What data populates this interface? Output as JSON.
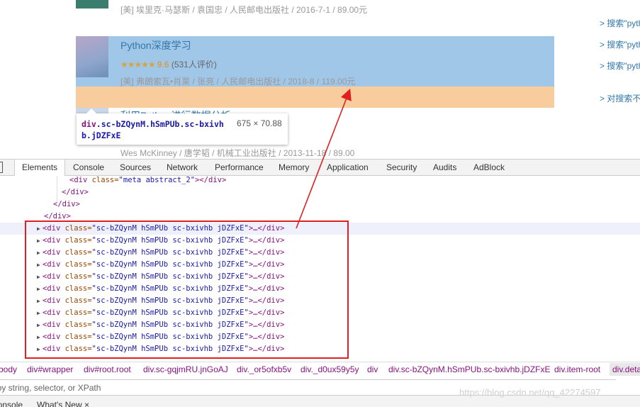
{
  "page": {
    "book_top_meta": "[美] 埃里克·马瑟斯 / 袁国忠 / 人民邮电出版社 / 2016-7-1 / 89.00元",
    "book_selected": {
      "title": "Python深度学习",
      "stars": "★★★★★",
      "score": "9.6",
      "ratings": "(531人评价)",
      "meta": "[美] 弗朗索瓦•肖莱 / 张亮 / 人民邮电出版社 / 2018-8 / 119.00元"
    },
    "book_next": {
      "title": "利用Python进行数据分析",
      "meta": "Wes McKinney / 唐学韬 / 机械工业出版社 / 2013-11-18 / 89.00"
    },
    "side_links": [
      "> 搜索\"pyth",
      "> 搜索\"pyth",
      "> 搜索\"pyth",
      "> 对搜索不"
    ]
  },
  "tooltip": {
    "el": "div",
    "selector": ".sc-bZQynM.hSmPUb.sc-bxivhb.jDZFxE",
    "size": "675 × 70.88"
  },
  "devtools": {
    "tabs": [
      "Elements",
      "Console",
      "Sources",
      "Network",
      "Performance",
      "Memory",
      "Application",
      "Security",
      "Audits",
      "AdBlock"
    ],
    "top_lines": [
      {
        "indent": "<div ",
        "attr": "class=",
        "val": "\"meta abstract_2\"",
        "tail": "></div>"
      },
      {
        "close": "</div>"
      },
      {
        "close": "</div>"
      },
      {
        "close": "</div>"
      }
    ],
    "node_line": {
      "open": "<div ",
      "attr": "class=",
      "val": "\"sc-bZQynM hSmPUb sc-bxivhb jDZFxE\"",
      "tail": ">…</div>"
    },
    "breadcrumbs": [
      "body",
      "div#wrapper",
      "div#root.root",
      "div.sc-gqjmRU.jnGoAJ",
      "div._or5ofxb5v",
      "div._d0ux59y5y",
      "div",
      "div.sc-bZQynM.hSmPUb.sc-bxivhb.jDZFxE",
      "div.item-root",
      "div.deta"
    ],
    "find_placeholder": "Find by string, selector, or XPath",
    "drawer_tabs": [
      "Console",
      "What's New ×"
    ]
  },
  "watermark": "https://blog.csdn.net/qq_42274597",
  "colors": {
    "highlight_content": "#6fa8dc",
    "highlight_margin": "#f6b26b",
    "annotation_red": "#e02020",
    "link_blue": "#3377aa"
  }
}
